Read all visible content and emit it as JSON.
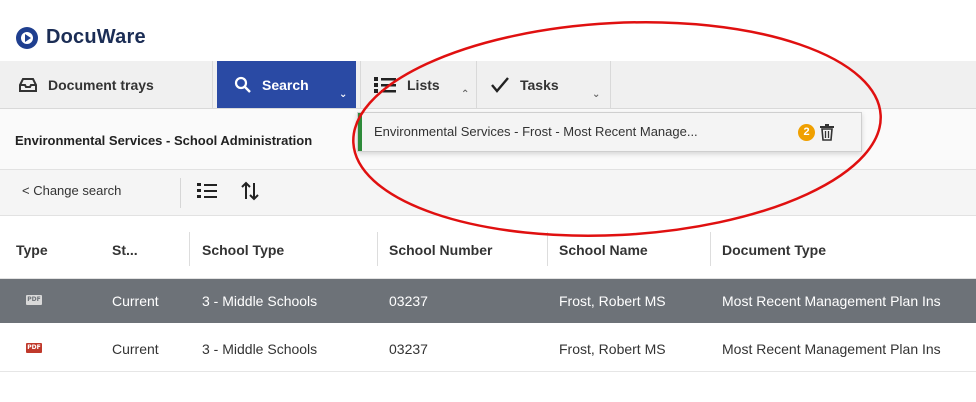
{
  "app": {
    "title": "DocuWare"
  },
  "tabs": [
    {
      "label": "Document trays",
      "icon": "tray-icon"
    },
    {
      "label": "Search",
      "icon": "search-icon"
    },
    {
      "label": "Lists",
      "icon": "list-icon"
    },
    {
      "label": "Tasks",
      "icon": "check-icon"
    }
  ],
  "breadcrumb": "Environmental Services - School Administration",
  "dropdown": {
    "label": "Environmental Services - Frost - Most Recent Manage...",
    "badge": "2"
  },
  "toolbar": {
    "change_search": "< Change search"
  },
  "table": {
    "columns": [
      "Type",
      "St...",
      "School Type",
      "School Number",
      "School Name",
      "Document Type"
    ],
    "rows": [
      {
        "type_icon": "PDF",
        "status": "Current",
        "school_type": "3 - Middle Schools",
        "school_number": "03237",
        "school_name": "Frost, Robert MS",
        "document_type": "Most Recent Management Plan Ins"
      },
      {
        "type_icon": "PDF",
        "status": "Current",
        "school_type": "3 - Middle Schools",
        "school_number": "03237",
        "school_name": "Frost, Robert MS",
        "document_type": "Most Recent Management Plan Ins"
      }
    ]
  },
  "colors": {
    "accent": "#2a4aa4",
    "badge": "#f0a000",
    "annotation": "#e01010",
    "selected_row": "#6d7278"
  }
}
